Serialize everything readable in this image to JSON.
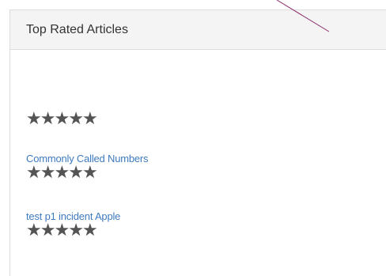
{
  "panel": {
    "title": "Top Rated Articles"
  },
  "articles": [
    {
      "title": "",
      "rating": 5,
      "max_rating": 5
    },
    {
      "title": "Commonly Called Numbers",
      "rating": 5,
      "max_rating": 5
    },
    {
      "title": "test p1 incident Apple",
      "rating": 5,
      "max_rating": 5
    }
  ],
  "star_glyph": "★",
  "colors": {
    "link": "#3f7bc1",
    "star": "#545454",
    "header_bg": "#f4f4f4",
    "annotation": "#8a2a6c"
  }
}
